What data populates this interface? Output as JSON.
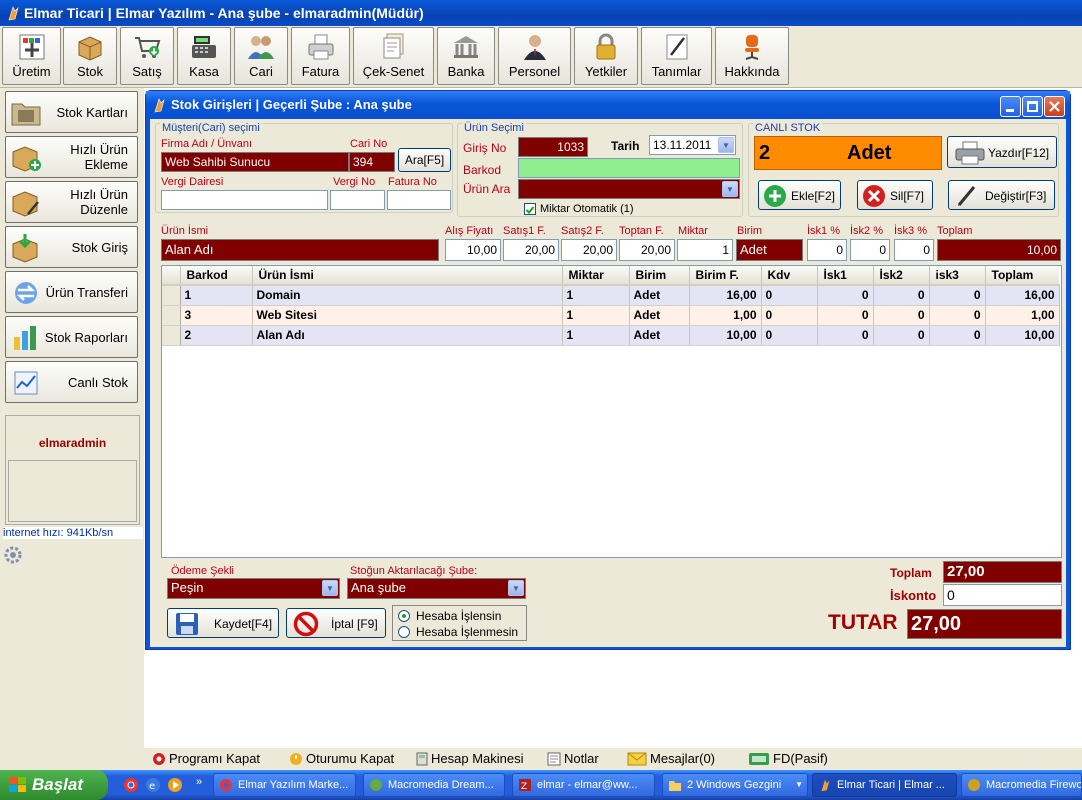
{
  "window": {
    "title": "Elmar Ticari | Elmar Yazılım - Ana şube - elmaradmin(Müdür)"
  },
  "toolbar": [
    {
      "label": "Üretim",
      "icon": "uretim-icon"
    },
    {
      "label": "Stok",
      "icon": "box-icon"
    },
    {
      "label": "Satış",
      "icon": "cart-icon"
    },
    {
      "label": "Kasa",
      "icon": "cash-register-icon"
    },
    {
      "label": "Cari",
      "icon": "users-icon"
    },
    {
      "label": "Fatura",
      "icon": "invoice-printer-icon"
    },
    {
      "label": "Çek-Senet",
      "icon": "documents-icon"
    },
    {
      "label": "Banka",
      "icon": "bank-icon"
    },
    {
      "label": "Personel",
      "icon": "person-icon"
    },
    {
      "label": "Yetkiler",
      "icon": "lock-icon"
    },
    {
      "label": "Tanımlar",
      "icon": "pen-icon"
    },
    {
      "label": "Hakkında",
      "icon": "chair-icon"
    }
  ],
  "sidebar": {
    "items": [
      {
        "label": "Stok Kartları",
        "icon": "folder-icon"
      },
      {
        "label": "Hızlı Ürün Ekleme",
        "icon": "box-add-icon"
      },
      {
        "label": "Hızlı Ürün Düzenle",
        "icon": "box-edit-icon"
      },
      {
        "label": "Stok Giriş",
        "icon": "box-in-icon"
      },
      {
        "label": "Ürün Transferi",
        "icon": "transfer-icon"
      },
      {
        "label": "Stok Raporları",
        "icon": "chart-icon"
      },
      {
        "label": "Canlı Stok",
        "icon": "live-chart-icon"
      }
    ],
    "username": "elmaradmin",
    "internet_speed": "internet hızı: 941Kb/sn"
  },
  "dialog": {
    "title": "Stok Girişleri | Geçerli Şube : Ana şube",
    "customer": {
      "group_label": "Müşteri(Cari) seçimi",
      "firm_label": "Firma Adı / Ünvanı",
      "firm_value": "Web Sahibi Sunucu",
      "cari_no_label": "Cari No",
      "cari_no_value": "394",
      "search_button": "Ara[F5]",
      "tax_office_label": "Vergi Dairesi",
      "tax_no_label": "Vergi No",
      "invoice_no_label": "Fatura No"
    },
    "product": {
      "group_label": "Ürün Seçimi",
      "entry_no_label": "Giriş No",
      "entry_no_value": "1033",
      "date_label": "Tarih",
      "date_value": "13.11.2011",
      "barcode_label": "Barkod",
      "search_label": "Ürün Ara",
      "auto_qty_label": "Miktar Otomatik (1)",
      "auto_qty_checked": true
    },
    "live_stock": {
      "group_label": "CANLI STOK",
      "quantity": "2",
      "unit": "Adet",
      "print_button": "Yazdır[F12]",
      "add_button": "Ekle[F2]",
      "delete_button": "Sil[F7]",
      "edit_button": "Değiştir[F3]"
    },
    "entry": {
      "labels": {
        "name": "Ürün İsmi",
        "buy_price": "Alış Fiyatı",
        "sale1": "Satış1 F.",
        "sale2": "Satış2 F.",
        "wholesale": "Toptan F.",
        "qty": "Miktar",
        "unit": "Birim",
        "disc1": "İsk1 %",
        "disc2": "İsk2 %",
        "disc3": "İsk3 %",
        "total": "Toplam"
      },
      "values": {
        "name": "Alan Adı",
        "buy_price": "10,00",
        "sale1": "20,00",
        "sale2": "20,00",
        "wholesale": "20,00",
        "qty": "1",
        "unit": "Adet",
        "disc1": "0",
        "disc2": "0",
        "disc3": "0",
        "total": "10,00"
      }
    },
    "table": {
      "columns": [
        "Barkod",
        "Ürün İsmi",
        "Miktar",
        "Birim",
        "Birim F.",
        "Kdv",
        "İsk1",
        "İsk2",
        "isk3",
        "Toplam"
      ],
      "rows": [
        [
          "1",
          "Domain",
          "1",
          "Adet",
          "16,00",
          "0",
          "0",
          "0",
          "0",
          "16,00"
        ],
        [
          "3",
          "Web Sitesi",
          "1",
          "Adet",
          "1,00",
          "0",
          "0",
          "0",
          "0",
          "1,00"
        ],
        [
          "2",
          "Alan Adı",
          "1",
          "Adet",
          "10,00",
          "0",
          "0",
          "0",
          "0",
          "10,00"
        ]
      ]
    },
    "footer": {
      "payment_label": "Ödeme Şekli",
      "payment_value": "Peşin",
      "branch_label": "Stoğun Aktarılacağı Şube:",
      "branch_value": "Ana şube",
      "save_button": "Kaydet[F4]",
      "cancel_button": "İptal [F9]",
      "radio_process": "Hesaba İşlensin",
      "radio_no_process": "Hesaba İşlenmesin",
      "radio_selected": "Hesaba İşlensin",
      "total_label": "Toplam",
      "total_value": "27,00",
      "discount_label": "İskonto",
      "discount_value": "0",
      "grand_label": "TUTAR",
      "grand_value": "27,00"
    }
  },
  "bottombar": [
    {
      "label": "Programı Kapat",
      "icon": "power-icon"
    },
    {
      "label": "Oturumu Kapat",
      "icon": "logout-icon"
    },
    {
      "label": "Hesap Makinesi",
      "icon": "calculator-icon"
    },
    {
      "label": "Notlar",
      "icon": "notes-icon"
    },
    {
      "label": "Mesajlar(0)",
      "icon": "mail-icon"
    },
    {
      "label": "FD(Pasif)",
      "icon": "fd-icon"
    }
  ],
  "taskbar": {
    "start": "Başlat",
    "tasks": [
      "Elmar Yazılım Marke...",
      "Macromedia Dream...",
      "elmar - elmar@ww...",
      "2 Windows Gezgini",
      "Elmar Ticari | Elmar ...",
      "Macromedia Firewo..."
    ]
  },
  "colors": {
    "field_dark": "#800000",
    "live_stock_orange": "#FF8C00",
    "barcode_green": "#90EE90",
    "row_odd": "#E4E4F5",
    "row_even": "#FFF0E8",
    "label_red": "#B8001A"
  }
}
